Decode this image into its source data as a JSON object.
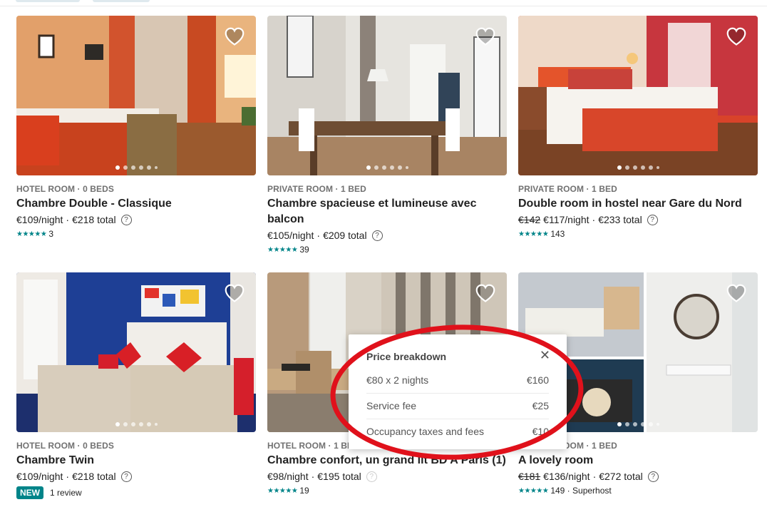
{
  "listings": [
    {
      "kind": "HOTEL ROOM · 0 BEDS",
      "title": "Chambre Double - Classique",
      "old_price": "",
      "price": "€109/night",
      "total": "€218 total",
      "stars": "★★★★★",
      "rating_count": "3",
      "badge": "",
      "extra": ""
    },
    {
      "kind": "PRIVATE ROOM · 1 BED",
      "title": "Chambre spacieuse et lumineuse avec balcon",
      "old_price": "",
      "price": "€105/night",
      "total": "€209 total",
      "stars": "★★★★★",
      "rating_count": "39",
      "badge": "",
      "extra": ""
    },
    {
      "kind": "PRIVATE ROOM · 1 BED",
      "title": "Double room in hostel near Gare du Nord",
      "old_price": "€142",
      "price": "€117/night",
      "total": "€233 total",
      "stars": "★★★★★",
      "rating_count": "143",
      "badge": "",
      "extra": ""
    },
    {
      "kind": "HOTEL ROOM · 0 BEDS",
      "title": "Chambre Twin",
      "old_price": "",
      "price": "€109/night",
      "total": "€218 total",
      "stars": "",
      "rating_count": "1 review",
      "badge": "NEW",
      "extra": ""
    },
    {
      "kind": "HOTEL ROOM · 1 BED",
      "title": "Chambre confort, un grand lit BD A Paris (1)",
      "old_price": "",
      "price": "€98/night",
      "total": "€195 total",
      "stars": "★★★★★",
      "rating_count": "19",
      "badge": "",
      "extra": ""
    },
    {
      "kind": "PRIVATE ROOM · 1 BED",
      "title": "A lovely room",
      "old_price": "€181",
      "price": "€136/night",
      "total": "€272 total",
      "stars": "★★★★★",
      "rating_count": "149 · Superhost",
      "badge": "",
      "extra": ""
    }
  ],
  "icons": {
    "heart": "heart-icon",
    "help": "question-circle-icon",
    "close": "close-icon",
    "star": "star-icon"
  },
  "separator": "·",
  "help_glyph": "?",
  "popover": {
    "title": "Price breakdown",
    "close_glyph": "✕",
    "rows": [
      {
        "label": "€80 x 2 nights",
        "value": "€160"
      },
      {
        "label": "Service fee",
        "value": "€25"
      },
      {
        "label": "Occupancy taxes and fees",
        "value": "€10"
      }
    ]
  },
  "colors": {
    "accent": "#008489",
    "annotation": "#e0111b"
  }
}
